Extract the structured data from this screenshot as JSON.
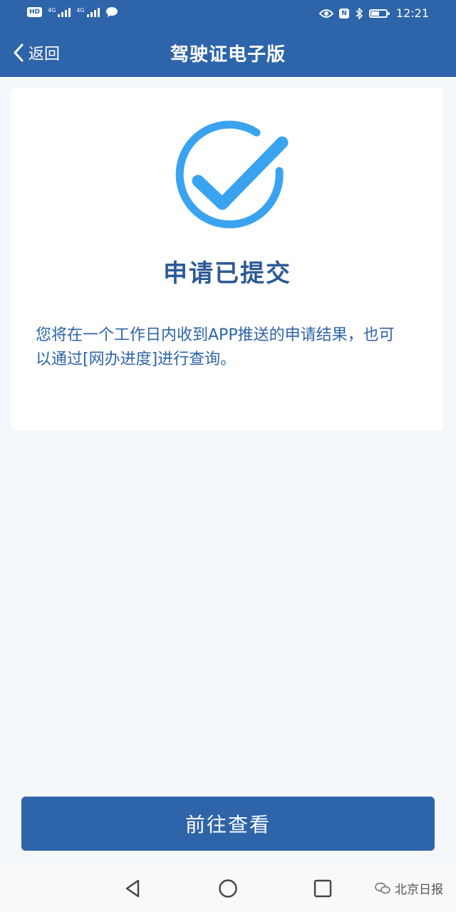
{
  "status_bar": {
    "hd_badge": "HD",
    "network_4g": "4G",
    "network_4g_2": "4G",
    "nfc_badge": "N",
    "time": "12:21"
  },
  "nav_bar": {
    "back_label": "返回",
    "title": "驾驶证电子版"
  },
  "result_card": {
    "title": "申请已提交",
    "message": "您将在一个工作日内收到APP推送的申请结果，也可以通过[网办进度]进行查询。"
  },
  "actions": {
    "view_label": "前往查看"
  },
  "watermark": {
    "text": "北京日报"
  },
  "colors": {
    "brand_blue": "#2e64a9",
    "success_blue": "#3aa3f0",
    "title_blue": "#2d5a97",
    "background": "#f4f7fa"
  },
  "icons": {
    "back": "chevron-left-icon",
    "success": "check-circle-icon",
    "nav_back": "triangle-back-icon",
    "nav_home": "circle-home-icon",
    "nav_recents": "square-recents-icon",
    "watermark": "wechat-icon"
  }
}
